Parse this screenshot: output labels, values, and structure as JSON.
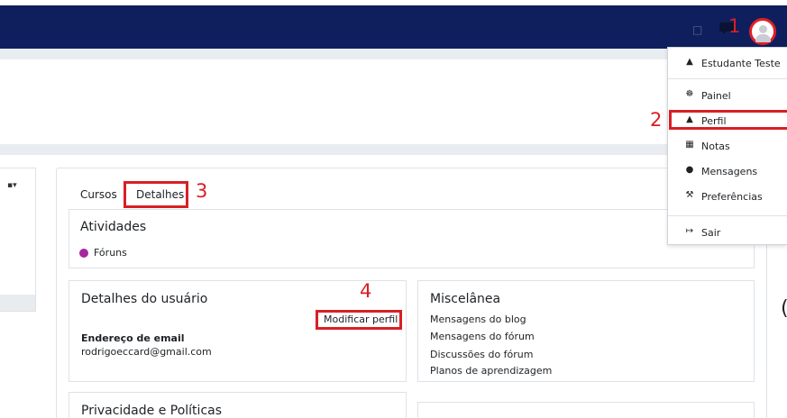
{
  "annotations": {
    "one": "1",
    "two": "2",
    "three": "3",
    "four": "4"
  },
  "user_menu": {
    "header_name": "Estudante Teste",
    "items": [
      {
        "label": "Painel",
        "icon": "dashboard-icon"
      },
      {
        "label": "Perfil",
        "icon": "user-icon"
      },
      {
        "label": "Notas",
        "icon": "table-icon"
      },
      {
        "label": "Mensagens",
        "icon": "message-icon"
      },
      {
        "label": "Preferências",
        "icon": "wrench-icon"
      }
    ],
    "logout": "Sair"
  },
  "tabs": {
    "cursos": "Cursos",
    "detalhes": "Detalhes"
  },
  "atividades": {
    "title": "Atividades",
    "forums": "Fóruns"
  },
  "user_details": {
    "title": "Detalhes do usuário",
    "edit_link": "Modificar perfil",
    "email_label": "Endereço de email",
    "email_value": "rodrigoeccard@gmail.com"
  },
  "misc": {
    "title": "Miscelânea",
    "links": [
      "Mensagens do blog",
      "Mensagens do fórum",
      "Discussões do fórum",
      "Planos de aprendizagem"
    ]
  },
  "privacy": {
    "title": "Privacidade e Políticas"
  },
  "colors": {
    "nav": "#0f1f5e",
    "annotation": "#d81f26",
    "forum_icon": "#a626a0"
  }
}
